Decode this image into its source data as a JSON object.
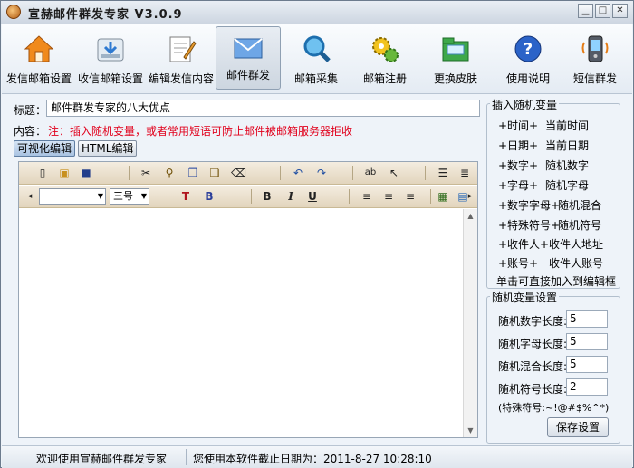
{
  "window": {
    "title": "宣赫邮件群发专家  V3.0.9",
    "min": "▁",
    "max": "□",
    "close": "✕"
  },
  "toolbar": {
    "items": [
      {
        "label": "发信邮箱设置",
        "icon": "home-icon"
      },
      {
        "label": "收信邮箱设置",
        "icon": "inbox-download-icon"
      },
      {
        "label": "编辑发信内容",
        "icon": "edit-note-icon"
      },
      {
        "label": "邮件群发",
        "icon": "envelope-icon"
      },
      {
        "label": "邮箱采集",
        "icon": "magnifier-icon"
      },
      {
        "label": "邮箱注册",
        "icon": "gears-icon"
      },
      {
        "label": "更换皮肤",
        "icon": "skin-folder-icon"
      },
      {
        "label": "使用说明",
        "icon": "help-icon"
      },
      {
        "label": "短信群发",
        "icon": "mobile-phone-icon"
      }
    ],
    "active_index": 3
  },
  "form": {
    "subject_label": "标题：",
    "subject_value": "邮件群发专家的八大优点",
    "content_label": "内容：",
    "note": "注：插入随机变量，或者常用短语可防止邮件被邮箱服务器拒收",
    "mode_visual": "可视化编辑",
    "mode_html": "HTML编辑"
  },
  "editor": {
    "font_name": "",
    "font_size": "三号",
    "toolbar1_icons": [
      "new-doc-icon",
      "open-folder-icon",
      "save-icon",
      "cut-icon",
      "copy-icon",
      "paste-icon",
      "paste-word-icon",
      "erase-icon",
      "undo-icon",
      "redo-icon",
      "spellcheck-icon",
      "select-icon",
      "ordered-list-icon",
      "unordered-list-icon"
    ],
    "toolbar2_icons": [
      "font-color-icon",
      "bg-color-icon",
      "bold-icon",
      "italic-icon",
      "underline-icon",
      "align-left-icon",
      "align-center-icon",
      "align-right-icon",
      "insert-image-icon",
      "insert-table-icon"
    ]
  },
  "vars": {
    "title": "插入随机变量",
    "items": [
      {
        "tag": "+时间+",
        "desc": "当前时间"
      },
      {
        "tag": "+日期+",
        "desc": "当前日期"
      },
      {
        "tag": "+数字+",
        "desc": "随机数字"
      },
      {
        "tag": "+字母+",
        "desc": "随机字母"
      },
      {
        "tag": "+数字字母+",
        "desc": "随机混合"
      },
      {
        "tag": "+特殊符号+",
        "desc": "随机符号"
      },
      {
        "tag": "+收件人+",
        "desc": "收件人地址"
      },
      {
        "tag": "+账号+",
        "desc": "收件人账号"
      }
    ],
    "hint": "单击可直接加入到编辑框"
  },
  "settings": {
    "title": "随机变量设置",
    "fields": [
      {
        "label": "随机数字长度:",
        "value": "5"
      },
      {
        "label": "随机字母长度:",
        "value": "5"
      },
      {
        "label": "随机混合长度:",
        "value": "5"
      },
      {
        "label": "随机符号长度:",
        "value": "2"
      }
    ],
    "special": "(特殊符号:~!@#$%^*)",
    "save_label": "保存设置"
  },
  "status": {
    "welcome": "欢迎使用宣赫邮件群发专家",
    "expiry": "您使用本软件截止日期为：2011-8-27 10:28:10"
  }
}
